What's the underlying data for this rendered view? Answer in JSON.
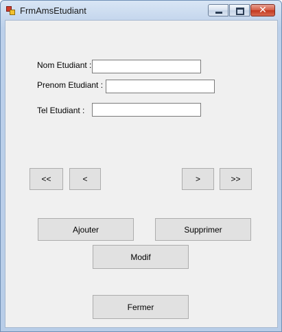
{
  "window": {
    "title": "FrmAmsEtudiant",
    "controls": {
      "minimize_icon": "minimize-icon",
      "maximize_icon": "maximize-icon",
      "close_glyph": "✕"
    }
  },
  "form": {
    "nom_label": "Nom Etudiant :",
    "nom_value": "",
    "prenom_label": "Prenom Etudiant  :",
    "prenom_value": "",
    "tel_label": "Tel Etudiant :",
    "tel_value": ""
  },
  "navigation": {
    "first": "<<",
    "previous": "<",
    "next": ">",
    "last": ">>"
  },
  "actions": {
    "ajouter": "Ajouter",
    "supprimer": "Supprimer",
    "modif": "Modif",
    "fermer": "Fermer"
  }
}
